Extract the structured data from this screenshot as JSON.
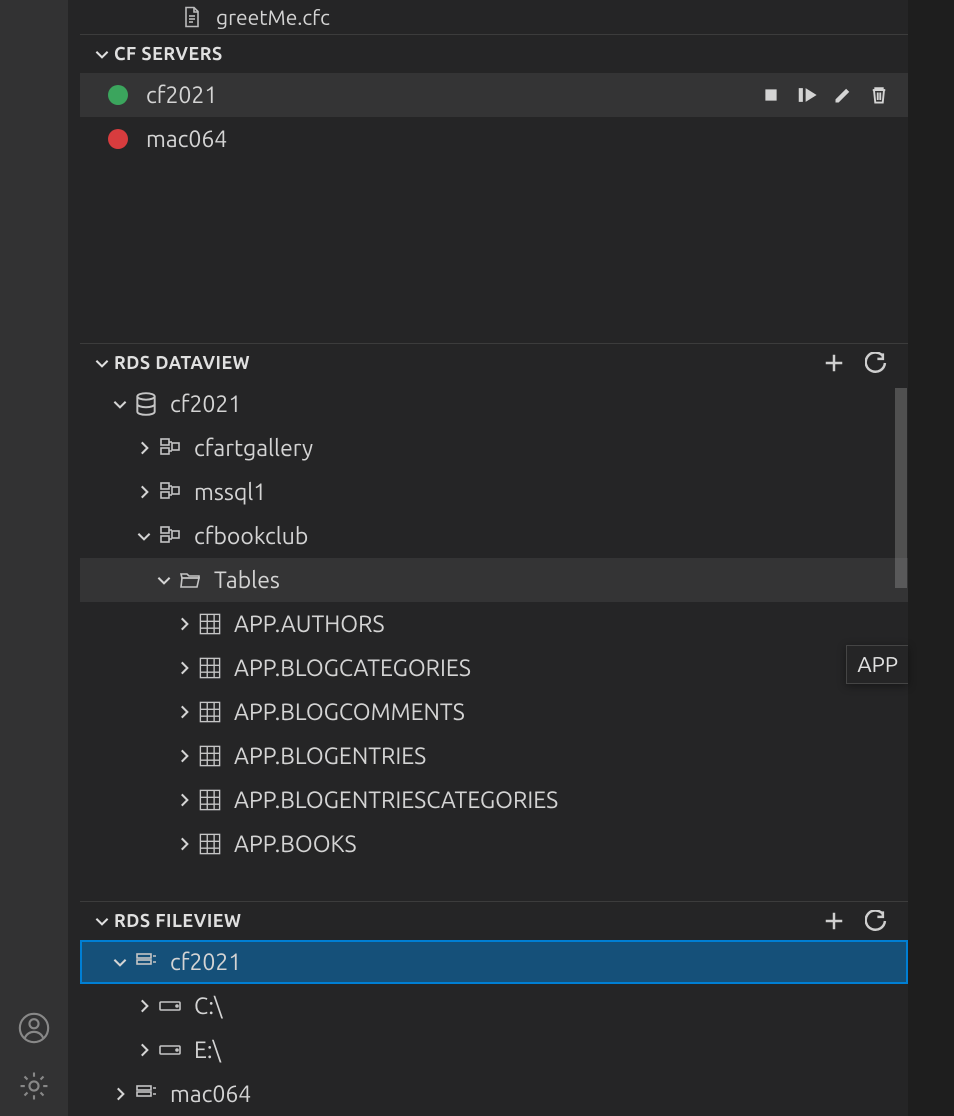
{
  "explorer": {
    "file": {
      "name": "greetMe.cfc"
    }
  },
  "cfServers": {
    "title": "CF SERVERS",
    "items": [
      {
        "name": "cf2021",
        "status": "green",
        "active": true
      },
      {
        "name": "mac064",
        "status": "red",
        "active": false
      }
    ]
  },
  "rdsDataview": {
    "title": "RDS DATAVIEW",
    "root": {
      "name": "cf2021",
      "expanded": true,
      "databases": [
        {
          "name": "cfartgallery",
          "expanded": false
        },
        {
          "name": "mssql1",
          "expanded": false
        },
        {
          "name": "cfbookclub",
          "expanded": true,
          "tablesLabel": "Tables",
          "tables": [
            "APP.AUTHORS",
            "APP.BLOGCATEGORIES",
            "APP.BLOGCOMMENTS",
            "APP.BLOGENTRIES",
            "APP.BLOGENTRIESCATEGORIES",
            "APP.BOOKS"
          ]
        }
      ]
    }
  },
  "rdsFileview": {
    "title": "RDS FILEVIEW",
    "roots": [
      {
        "name": "cf2021",
        "expanded": true,
        "selected": true,
        "drives": [
          {
            "name": "C:\\"
          },
          {
            "name": "E:\\"
          }
        ]
      },
      {
        "name": "mac064",
        "expanded": false
      }
    ]
  },
  "tooltip": {
    "text": "APP"
  }
}
